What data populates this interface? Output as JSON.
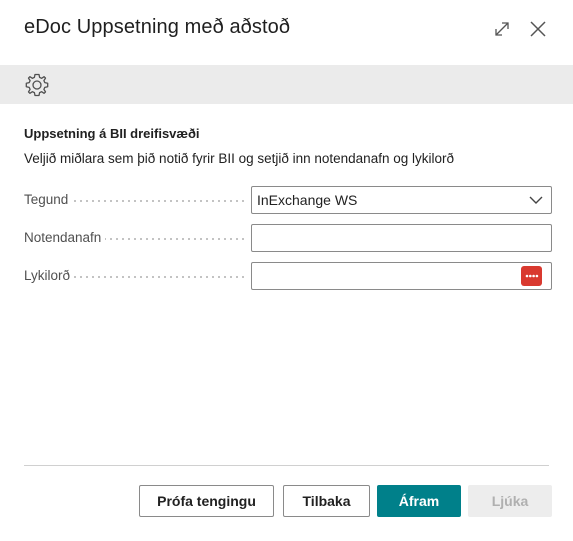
{
  "dialog": {
    "title": "eDoc Uppsetning með aðstoð",
    "icons": {
      "expand": "expand-icon",
      "close": "close-icon",
      "settings": "gear-icon"
    }
  },
  "section": {
    "title": "Uppsetning á BII dreifisvæði",
    "description": "Veljið miðlara sem þið notið fyrir BII og setjið inn notendanafn og lykilorð"
  },
  "fields": {
    "type": {
      "label": "Tegund",
      "value": "InExchange WS"
    },
    "username": {
      "label": "Notendanafn",
      "value": ""
    },
    "password": {
      "label": "Lykilorð",
      "value": ""
    }
  },
  "buttons": {
    "test_connection": "Prófa tengingu",
    "back": "Tilbaka",
    "next": "Áfram",
    "finish": "Ljúka"
  },
  "colors": {
    "primary": "#00808a",
    "password_button": "#d9392f",
    "toolbar_bg": "#ebebeb"
  }
}
